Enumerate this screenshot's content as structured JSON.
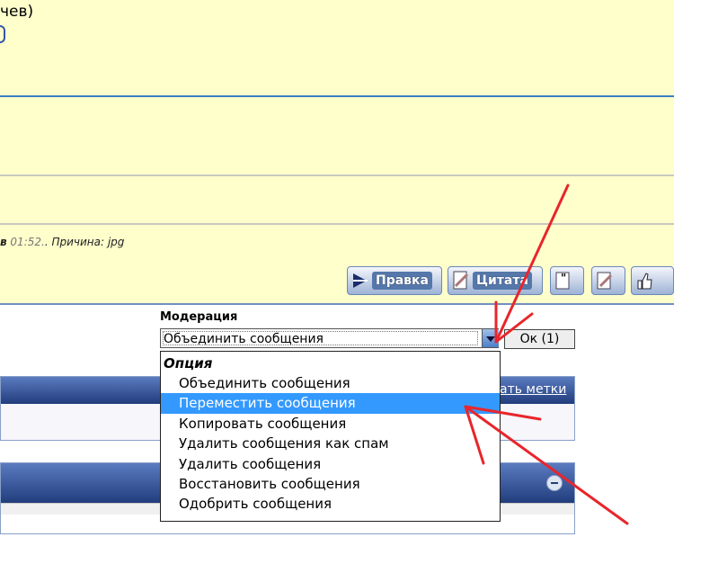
{
  "post": {
    "text_line1": "чев)",
    "edit_note_prefix": "в",
    "edit_time": "01:52.",
    "edit_reason": ". Причина: jpg"
  },
  "buttons": {
    "edit": "Правка",
    "quote": "Цитата"
  },
  "moderation": {
    "label": "Модерация",
    "selected": "Объединить сообщения",
    "ok_button": "Ок (1)",
    "options_group": "Опция",
    "options": [
      "Объединить сообщения",
      "Переместить сообщения",
      "Копировать сообщения",
      "Удалить сообщения как спам",
      "Удалить сообщения",
      "Восстановить сообщения",
      "Одобрить сообщения"
    ],
    "highlighted_index": 1
  },
  "tags_link": "ать метки",
  "colors": {
    "post_bg": "#ffffcc",
    "highlight": "#3399ff",
    "header_blue": "#213d7c",
    "annotation_red": "#e8262b"
  }
}
